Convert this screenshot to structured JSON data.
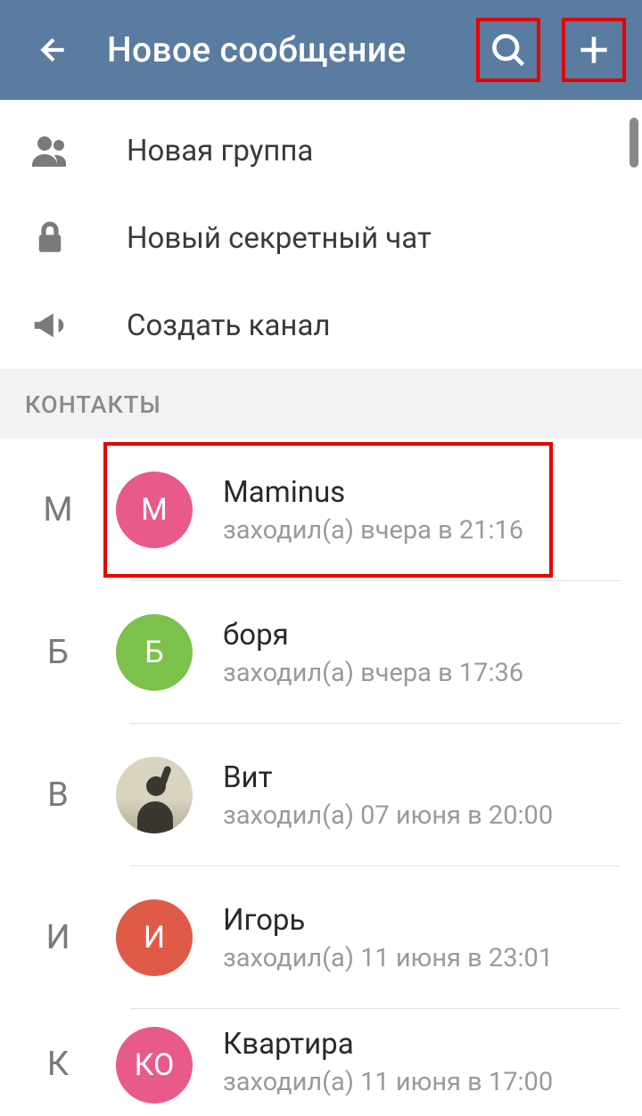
{
  "header": {
    "title": "Новое сообщение"
  },
  "options": [
    {
      "label": "Новая группа",
      "icon": "group"
    },
    {
      "label": "Новый секретный чат",
      "icon": "lock"
    },
    {
      "label": "Создать канал",
      "icon": "megaphone"
    }
  ],
  "section_title": "КОНТАКТЫ",
  "contacts": [
    {
      "letter": "М",
      "avatar_letter": "М",
      "avatar_color": "pink",
      "name": "Maminus",
      "status": "заходил(а) вчера в 21:16",
      "highlighted": true
    },
    {
      "letter": "Б",
      "avatar_letter": "Б",
      "avatar_color": "green",
      "name": "боря",
      "status": "заходил(а) вчера в 17:36"
    },
    {
      "letter": "В",
      "avatar_letter": "",
      "avatar_color": "photo",
      "name": "Вит",
      "status": "заходил(а) 07 июня в 20:00"
    },
    {
      "letter": "И",
      "avatar_letter": "И",
      "avatar_color": "red",
      "name": "Игорь",
      "status": "заходил(а) 11 июня в 23:01"
    },
    {
      "letter": "К",
      "avatar_letter": "КО",
      "avatar_color": "pink",
      "name": "Квартира",
      "status": "заходил(а) 11 июня в 17:00"
    }
  ]
}
